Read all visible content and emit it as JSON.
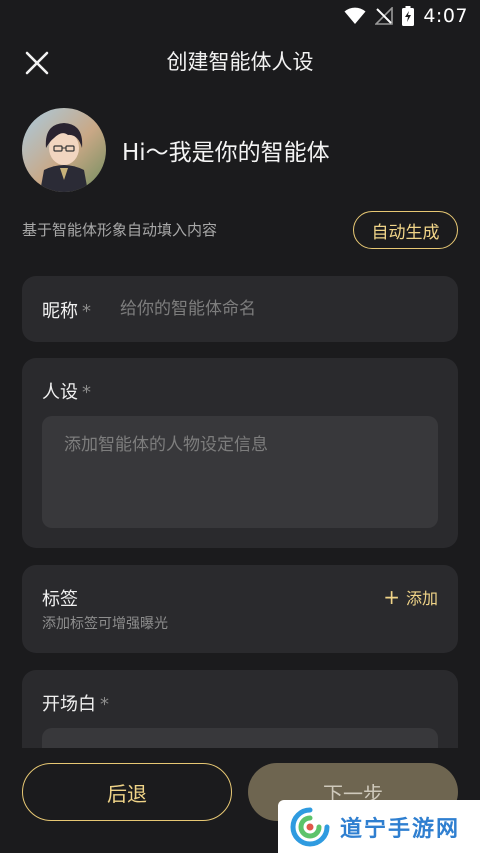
{
  "status_bar": {
    "time": "4:07",
    "icons": [
      "wifi-icon",
      "no-signal-icon",
      "battery-charging-icon"
    ]
  },
  "header": {
    "title": "创建智能体人设",
    "close_icon": "close-icon"
  },
  "profile": {
    "greeting": "Hi～我是你的智能体"
  },
  "autofill": {
    "hint": "基于智能体形象自动填入内容",
    "button_label": "自动生成"
  },
  "form": {
    "nickname": {
      "label": "昵称",
      "required_mark": "*",
      "placeholder": "给你的智能体命名",
      "value": ""
    },
    "persona": {
      "label": "人设",
      "required_mark": "*",
      "placeholder": "添加智能体的人物设定信息",
      "value": ""
    },
    "tags": {
      "label": "标签",
      "hint": "添加标签可增强曝光",
      "add_label": "添加",
      "add_icon": "plus-icon"
    },
    "opening": {
      "label": "开场白",
      "required_mark": "*"
    }
  },
  "footer": {
    "back_label": "后退",
    "next_label": "下一步"
  },
  "watermark": {
    "text": "道宁手游网"
  },
  "colors": {
    "background": "#1b1b1d",
    "card": "#2a2a2d",
    "accent": "#e7c874",
    "next_button": "#6e6550"
  }
}
